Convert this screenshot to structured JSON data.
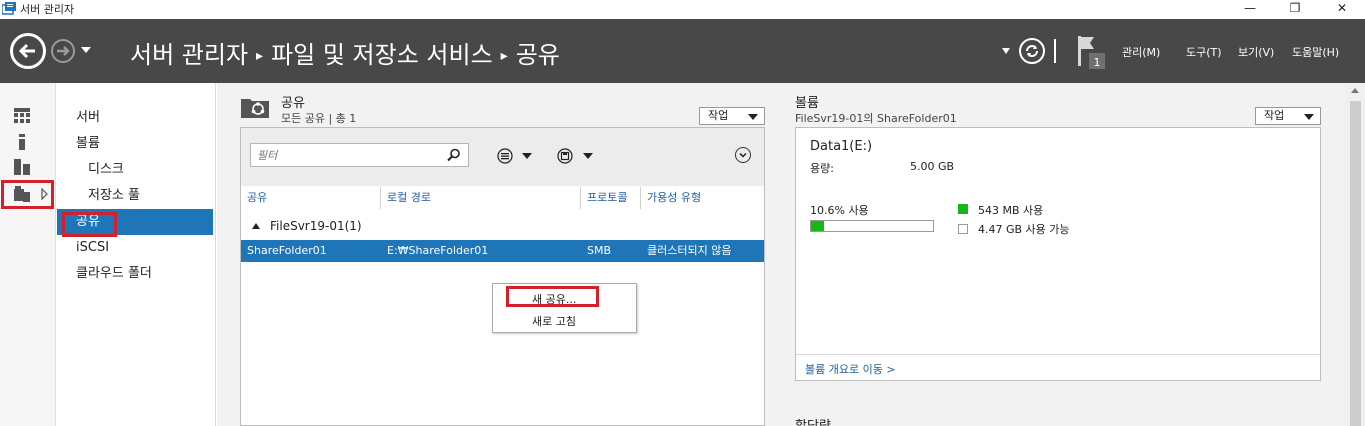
{
  "window": {
    "title": "서버 관리자",
    "minimize": "—",
    "restore": "❐",
    "close": "✕"
  },
  "header": {
    "breadcrumb": [
      "서버 관리자",
      "파일 및 저장소 서비스",
      "공유"
    ],
    "breadcrumb_separator": "▸",
    "notification_count": "1",
    "menus": [
      "관리(M)",
      "도구(T)",
      "보기(V)",
      "도움말(H)"
    ]
  },
  "nav": {
    "items": [
      {
        "label": "서버"
      },
      {
        "label": "볼륨"
      },
      {
        "label": "디스크"
      },
      {
        "label": "저장소 풀"
      },
      {
        "label": "공유"
      },
      {
        "label": "iSCSI"
      },
      {
        "label": "클라우드 폴더"
      }
    ]
  },
  "shares": {
    "title": "공유",
    "subtitle": "모든 공유 | 총 1",
    "task_label": "작업",
    "filter_placeholder": "필터",
    "columns": [
      "공유",
      "로컬 경로",
      "프로토콜",
      "가용성 유형"
    ],
    "group_label": "FileSvr19-01(1)",
    "rows": [
      {
        "share": "ShareFolder01",
        "path": "E:₩ShareFolder01",
        "protocol": "SMB",
        "availability": "클러스터되지 않음"
      }
    ],
    "context_menu": [
      "새 공유...",
      "새로 고침"
    ]
  },
  "volume": {
    "title": "볼륨",
    "subtitle": "FileSvr19-01의 ShareFolder01",
    "task_label": "작업",
    "name": "Data1(E:)",
    "capacity_label": "용량:",
    "capacity_value": "5.00 GB",
    "used_percent_label": "10.6% 사용",
    "used_fraction": 0.106,
    "used_label": "543 MB 사용",
    "free_label": "4.47 GB 사용 가능",
    "link": "볼륨 개요로 이동 >",
    "used_color": "#16b816"
  },
  "quota": {
    "title": "할당량"
  },
  "colors": {
    "header_bg": "#484848",
    "selection": "#1e76b8",
    "highlight_box": "#d4202b"
  }
}
